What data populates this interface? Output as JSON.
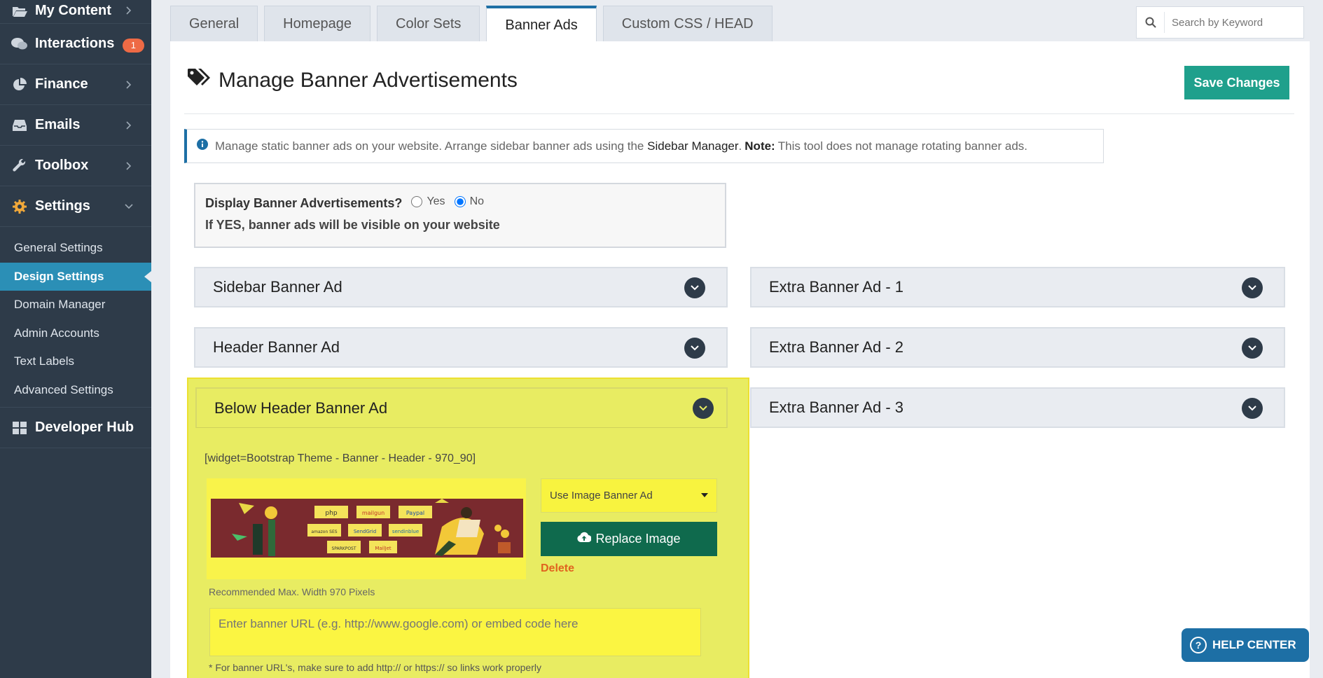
{
  "sidebar": {
    "items": [
      {
        "label": "My Content",
        "icon": "folder-open-icon"
      },
      {
        "label": "Interactions",
        "icon": "comments-icon",
        "badge": "1"
      },
      {
        "label": "Finance",
        "icon": "pie-chart-icon"
      },
      {
        "label": "Emails",
        "icon": "inbox-icon"
      },
      {
        "label": "Toolbox",
        "icon": "wrench-icon"
      },
      {
        "label": "Settings",
        "icon": "gear-icon"
      }
    ],
    "settings_sub": [
      "General Settings",
      "Design Settings",
      "Domain Manager",
      "Admin Accounts",
      "Text Labels",
      "Advanced Settings"
    ],
    "developer_hub": {
      "label": "Developer Hub",
      "icon": "grid-icon"
    }
  },
  "tabs": [
    "General",
    "Homepage",
    "Color Sets",
    "Banner Ads",
    "Custom CSS / HEAD"
  ],
  "active_tab": "Banner Ads",
  "search": {
    "placeholder": "Search by Keyword"
  },
  "main": {
    "title": "Manage Banner Advertisements",
    "save_label": "Save Changes",
    "info": {
      "text1": "Manage static banner ads on your website. Arrange sidebar banner ads using the",
      "link": "Sidebar Manager",
      "text2": ".",
      "note_label": "Note:",
      "text3": "This tool does not manage rotating banner ads."
    },
    "display": {
      "question": "Display Banner Advertisements?",
      "yes": "Yes",
      "no": "No",
      "selected": "No",
      "hint": "If YES, banner ads will be visible on your website"
    },
    "left_sections": [
      "Sidebar Banner Ad",
      "Header Banner Ad"
    ],
    "right_sections": [
      "Extra Banner Ad - 1",
      "Extra Banner Ad - 2",
      "Extra Banner Ad - 3"
    ],
    "expanded": {
      "title": "Below Header Banner Ad",
      "widget": "[widget=Bootstrap Theme - Banner - Header - 970_90]",
      "select_value": "Use Image Banner Ad",
      "replace_label": "Replace Image",
      "delete_label": "Delete",
      "recommended": "Recommended Max. Width 970 Pixels",
      "url_placeholder": "Enter banner URL (e.g. http://www.google.com) or embed code here",
      "note": "* For banner URL's, make sure to add http:// or https:// so links work properly",
      "banner_logos": [
        "php",
        "mailgun",
        "Paypal",
        "amazon SES",
        "SendGrid",
        "sendinblue",
        "SPARKPOST",
        "MailJet"
      ]
    }
  },
  "help": {
    "label": "HELP CENTER"
  },
  "colors": {
    "sidebar": "#2e3b49",
    "accent": "#1d6fa5",
    "save": "#1fa08c",
    "highlight": "#e8ec62",
    "badge": "#ee6a45",
    "replace": "#0f6a4d"
  }
}
